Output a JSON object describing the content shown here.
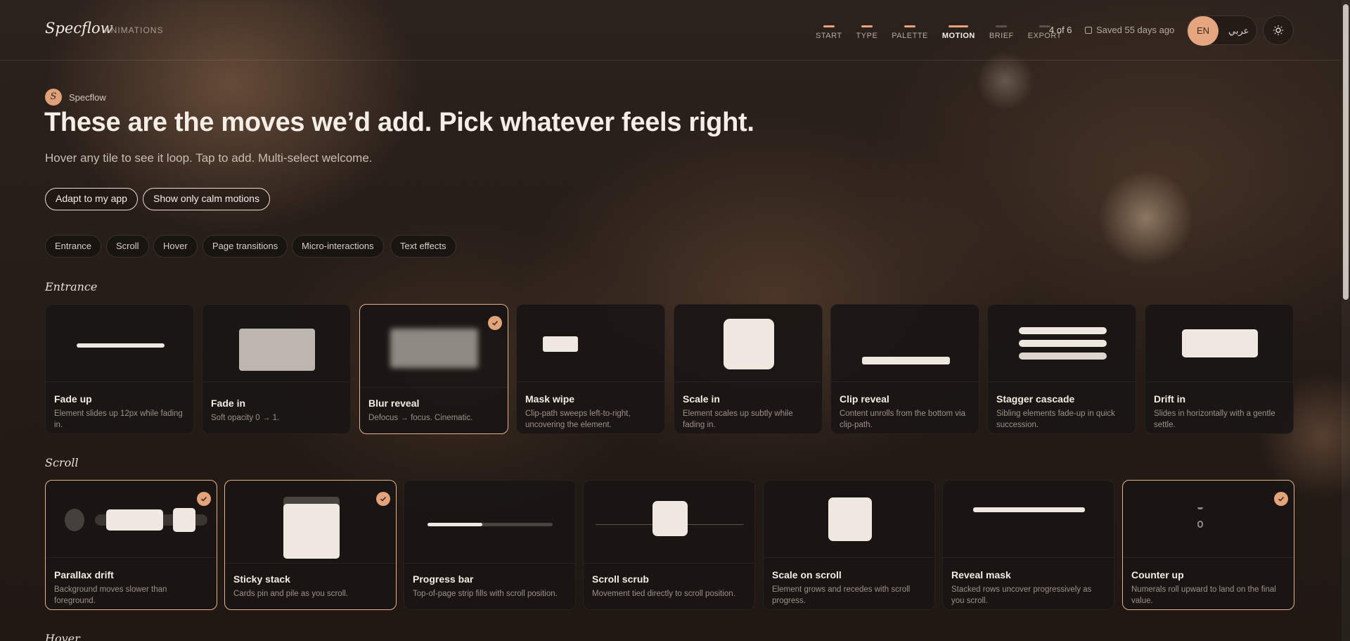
{
  "header": {
    "logo": "Specflow",
    "crumb": "· ANIMATIONS",
    "steps": [
      {
        "label": "START",
        "state": "done"
      },
      {
        "label": "TYPE",
        "state": "done"
      },
      {
        "label": "PALETTE",
        "state": "done"
      },
      {
        "label": "MOTION",
        "state": "active"
      },
      {
        "label": "BRIEF",
        "state": "todo"
      },
      {
        "label": "EXPORT",
        "state": "todo"
      }
    ],
    "progress": "4 of 6",
    "saved": "Saved 55 days ago",
    "lang_en": "EN",
    "lang_ar": "عربي"
  },
  "hero": {
    "brand_badge": "S",
    "brand": "Specflow",
    "title": "These are the moves we’d add. Pick whatever feels right.",
    "subtitle": "Hover any tile to see it loop. Tap to add. Multi-select welcome.",
    "actions": [
      "Adapt to my app",
      "Show only calm motions"
    ]
  },
  "filters": [
    "Entrance",
    "Scroll",
    "Hover",
    "Page transitions",
    "Micro-interactions",
    "Text effects"
  ],
  "sections": {
    "entrance": {
      "title": "Entrance",
      "cards": [
        {
          "title": "Fade up",
          "desc": "Element slides up 12px while fading in.",
          "selected": false
        },
        {
          "title": "Fade in",
          "desc": "Soft opacity 0 → 1.",
          "selected": false
        },
        {
          "title": "Blur reveal",
          "desc": "Defocus → focus. Cinematic.",
          "selected": true
        },
        {
          "title": "Mask wipe",
          "desc": "Clip-path sweeps left-to-right, uncovering the element.",
          "selected": false
        },
        {
          "title": "Scale in",
          "desc": "Element scales up subtly while fading in.",
          "selected": false
        },
        {
          "title": "Clip reveal",
          "desc": "Content unrolls from the bottom via clip-path.",
          "selected": false
        },
        {
          "title": "Stagger cascade",
          "desc": "Sibling elements fade-up in quick succession.",
          "selected": false
        },
        {
          "title": "Drift in",
          "desc": "Slides in horizontally with a gentle settle.",
          "selected": false
        }
      ]
    },
    "scroll": {
      "title": "Scroll",
      "cards": [
        {
          "title": "Parallax drift",
          "desc": "Background moves slower than foreground.",
          "selected": true
        },
        {
          "title": "Sticky stack",
          "desc": "Cards pin and pile as you scroll.",
          "selected": true
        },
        {
          "title": "Progress bar",
          "desc": "Top-of-page strip fills with scroll position.",
          "selected": false
        },
        {
          "title": "Scroll scrub",
          "desc": "Movement tied directly to scroll position.",
          "selected": false
        },
        {
          "title": "Scale on scroll",
          "desc": "Element grows and recedes with scroll progress.",
          "selected": false
        },
        {
          "title": "Reveal mask",
          "desc": "Stacked rows uncover progressively as you scroll.",
          "selected": false
        },
        {
          "title": "Counter up",
          "desc": "Numerals roll upward to land on the final value.",
          "selected": true
        }
      ]
    },
    "hover": {
      "title": "Hover"
    }
  },
  "accent": "#e3a47c"
}
